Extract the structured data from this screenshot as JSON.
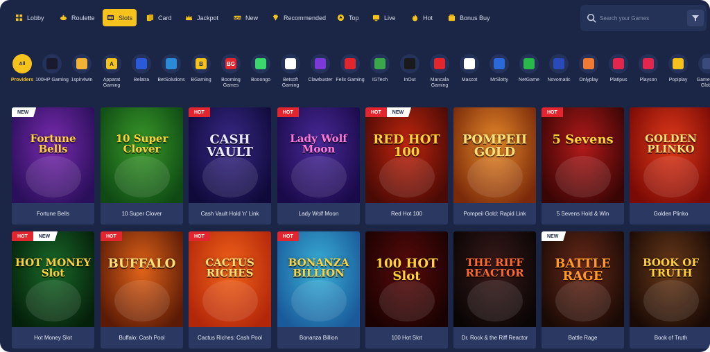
{
  "nav": {
    "items": [
      {
        "label": "Lobby",
        "icon": "lobby-icon",
        "active": false
      },
      {
        "label": "Roulette",
        "icon": "roulette-icon",
        "active": false
      },
      {
        "label": "Slots",
        "icon": "slots-icon",
        "active": true
      },
      {
        "label": "Card",
        "icon": "card-icon",
        "active": false
      },
      {
        "label": "Jackpot",
        "icon": "jackpot-icon",
        "active": false
      },
      {
        "label": "New",
        "icon": "new-icon",
        "active": false
      },
      {
        "label": "Recommended",
        "icon": "diamond-icon",
        "active": false
      },
      {
        "label": "Top",
        "icon": "top-icon",
        "active": false
      },
      {
        "label": "Live",
        "icon": "live-icon",
        "active": false
      },
      {
        "label": "Hot",
        "icon": "flame-icon",
        "active": false
      },
      {
        "label": "Bonus Buy",
        "icon": "bonus-buy-icon",
        "active": false
      }
    ],
    "search_placeholder": "Search your Games"
  },
  "providers": [
    {
      "label": "Providers",
      "logo_text": "All",
      "active": true
    },
    {
      "label": "100HP Gaming",
      "logo_text": "",
      "color": "#1a1a2e"
    },
    {
      "label": "1spin4win",
      "logo_text": "",
      "color": "#f2b233"
    },
    {
      "label": "Apparat Gaming",
      "logo_text": "A",
      "color": "#f6c21c"
    },
    {
      "label": "Belatra",
      "logo_text": "",
      "color": "#2a5ad8"
    },
    {
      "label": "BetSolutions",
      "logo_text": "",
      "color": "#2a8ad8"
    },
    {
      "label": "BGaming",
      "logo_text": "B",
      "color": "#f6c21c"
    },
    {
      "label": "Booming Games",
      "logo_text": "BG",
      "color": "#e3262d"
    },
    {
      "label": "Booongo",
      "logo_text": "",
      "color": "#3ad86a"
    },
    {
      "label": "Betsoft Gaming",
      "logo_text": "",
      "color": "#ffffff"
    },
    {
      "label": "Clawbuster",
      "logo_text": "",
      "color": "#7b3ad8"
    },
    {
      "label": "Felix Gaming",
      "logo_text": "",
      "color": "#e3262d"
    },
    {
      "label": "IGTech",
      "logo_text": "",
      "color": "#3aa84a"
    },
    {
      "label": "InOut",
      "logo_text": "",
      "color": "#1a1a1a"
    },
    {
      "label": "Mancala Gaming",
      "logo_text": "",
      "color": "#e3262d"
    },
    {
      "label": "Mascot",
      "logo_text": "",
      "color": "#ffffff"
    },
    {
      "label": "MrSlotty",
      "logo_text": "",
      "color": "#2a6ad8"
    },
    {
      "label": "NetGame",
      "logo_text": "",
      "color": "#2ab84a"
    },
    {
      "label": "Novomatic",
      "logo_text": "",
      "color": "#2a4ab8"
    },
    {
      "label": "Onlyplay",
      "logo_text": "",
      "color": "#f27a33"
    },
    {
      "label": "Platipus",
      "logo_text": "",
      "color": "#e3264d"
    },
    {
      "label": "Playson",
      "logo_text": "",
      "color": "#e3264d"
    },
    {
      "label": "Popiplay",
      "logo_text": "",
      "color": "#f6c21c"
    },
    {
      "label": "Gamebeat Global",
      "logo_text": "",
      "color": "#3a4a7a"
    }
  ],
  "games": [
    {
      "title": "Fortune Bells",
      "art_text": "Fortune Bells",
      "badges": [
        "NEW"
      ],
      "bg1": "#7a2bb0",
      "bg2": "#2a0f5a",
      "fg": "#ffd23a"
    },
    {
      "title": "10 Super Clover",
      "art_text": "10 Super Clover",
      "badges": [],
      "bg1": "#3a9a2a",
      "bg2": "#0f4a14",
      "fg": "#ffd23a"
    },
    {
      "title": "Cash Vault Hold 'n' Link",
      "art_text": "CASH VAULT",
      "badges": [
        "HOT"
      ],
      "bg1": "#3a2a8a",
      "bg2": "#0f0a3a",
      "fg": "#e8e8ff"
    },
    {
      "title": "Lady Wolf Moon",
      "art_text": "Lady Wolf Moon",
      "badges": [
        "HOT"
      ],
      "bg1": "#4a2a9a",
      "bg2": "#1a0a4a",
      "fg": "#ff7ad8"
    },
    {
      "title": "Red Hot 100",
      "art_text": "RED HOT 100",
      "badges": [
        "HOT",
        "NEW"
      ],
      "bg1": "#c2260f",
      "bg2": "#4a0a05",
      "fg": "#ffd23a"
    },
    {
      "title": "Pompeii Gold: Rapid Link",
      "art_text": "POMPEII GOLD",
      "badges": [],
      "bg1": "#e88a2a",
      "bg2": "#7a2a0a",
      "fg": "#ffe07a"
    },
    {
      "title": "5 Sevens Hold & Win",
      "art_text": "5 Sevens",
      "badges": [
        "HOT"
      ],
      "bg1": "#b21a1a",
      "bg2": "#3a0505",
      "fg": "#ffd23a"
    },
    {
      "title": "Golden Plinko",
      "art_text": "GOLDEN PLINKO",
      "badges": [],
      "bg1": "#e23a1a",
      "bg2": "#7a0a05",
      "fg": "#ffe07a"
    },
    {
      "title": "Hot Money Slot",
      "art_text": "HOT MONEY Slot",
      "badges": [
        "HOT",
        "NEW"
      ],
      "bg1": "#1a6a2a",
      "bg2": "#05200a",
      "fg": "#ffd23a"
    },
    {
      "title": "Buffalo: Cash Pool",
      "art_text": "BUFFALO",
      "badges": [
        "HOT"
      ],
      "bg1": "#e2641a",
      "bg2": "#5a1a05",
      "fg": "#ffe07a"
    },
    {
      "title": "Cactus Riches: Cash Pool",
      "art_text": "CACTUS RICHES",
      "badges": [
        "HOT"
      ],
      "bg1": "#f2641a",
      "bg2": "#b2260a",
      "fg": "#ffe07a"
    },
    {
      "title": "Bonanza Billion",
      "art_text": "BONANZA BILLION",
      "badges": [
        "HOT"
      ],
      "bg1": "#3ab2d8",
      "bg2": "#1a5a9a",
      "fg": "#ffd23a"
    },
    {
      "title": "100 Hot Slot",
      "art_text": "100 HOT Slot",
      "badges": [],
      "bg1": "#5a0a0a",
      "bg2": "#1a0202",
      "fg": "#ffd23a"
    },
    {
      "title": "Dr. Rock & the Riff Reactor",
      "art_text": "THE RIFF REACTOR",
      "badges": [],
      "bg1": "#3a1a1a",
      "bg2": "#0a0505",
      "fg": "#ff6a2a"
    },
    {
      "title": "Battle Rage",
      "art_text": "BATTLE RAGE",
      "badges": [
        "NEW"
      ],
      "bg1": "#6a2a1a",
      "bg2": "#1a0a05",
      "fg": "#ff9a2a"
    },
    {
      "title": "Book of Truth",
      "art_text": "BOOK OF TRUTH",
      "badges": [],
      "bg1": "#6a3a1a",
      "bg2": "#1a0a05",
      "fg": "#ffd23a"
    }
  ]
}
